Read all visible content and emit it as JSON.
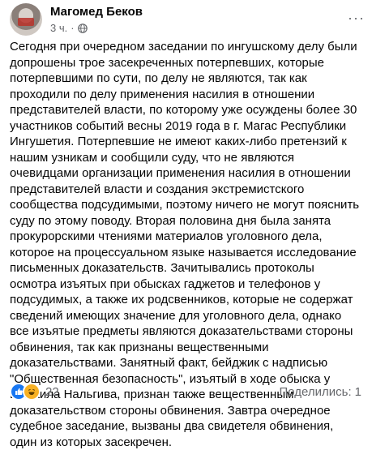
{
  "post": {
    "author": "Магомед Беков",
    "time": "3 ч.",
    "separator": "·",
    "more": "···",
    "text": "Сегодня при очередном заседании по ингушскому делу были допрошены трое засекреченных потерпевших, которые потерпевшими по сути, по делу не являются, так как проходили по делу применения насилия в отношении представителей власти, по которому уже осуждены более 30 участников событий весны 2019 года в г. Магас Республики Ингушетия. Потерпевшие не имеют каких-либо претензий к нашим узникам и сообщили суду, что не являются очевидцами организации применения насилия в отношении представителей власти и создания экстремистского сообщества подсудимыми, поэтому ничего не могут пояснить суду по этому поводу. Вторая половина дня была занята прокурорскими чтениями материалов уголовного дела, которое на процессуальном языке называется исследование письменных доказательств. Зачитывались протоколы осмотра изъятых при обысках гаджетов и телефонов у подсудимых, а также их родсвенников, которые не содержат сведений имеющих значение для уголовного дела, однако все изъятые предметы являются доказательствами стороны обвинения, так как признаны вещественными доказательствами. Занятный факт, бейджик с надписью \"Общественная безопасность\", изъятый в ходе обыска у Исмаила Нальгива, признан также вещественным доказательством стороны обвинения. Завтра очередное судебное заседание, вызваны два свидетеля обвинения, один из которых засекречен."
  },
  "footer": {
    "reaction_count": "22",
    "shares_label": "Поделились:",
    "shares_count": "1"
  },
  "icons": {
    "visibility": "globe-icon",
    "like": "like-reaction-icon",
    "haha": "haha-reaction-icon",
    "more": "more-options-icon"
  },
  "colors": {
    "like": "#1877f2",
    "haha": "#f7b125",
    "secondary_text": "#65676b"
  }
}
